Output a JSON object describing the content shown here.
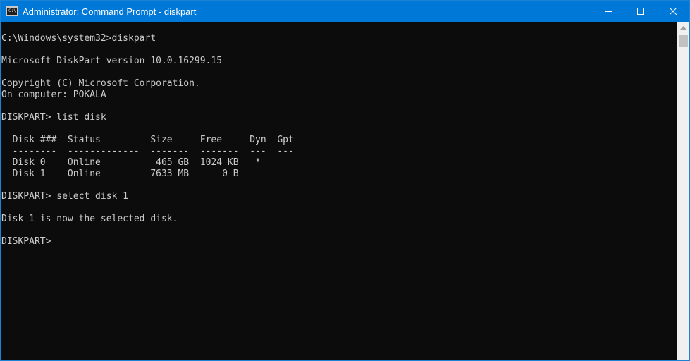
{
  "window": {
    "title": "Administrator: Command Prompt - diskpart",
    "icon_text": "C:\\"
  },
  "console": {
    "lines": [
      "",
      "C:\\Windows\\system32>diskpart",
      "",
      "Microsoft DiskPart version 10.0.16299.15",
      "",
      "Copyright (C) Microsoft Corporation.",
      "On computer: POKALA",
      "",
      "DISKPART> list disk",
      "",
      "  Disk ###  Status         Size     Free     Dyn  Gpt",
      "  --------  -------------  -------  -------  ---  ---",
      "  Disk 0    Online          465 GB  1024 KB   *",
      "  Disk 1    Online         7633 MB      0 B",
      "",
      "DISKPART> select disk 1",
      "",
      "Disk 1 is now the selected disk.",
      "",
      "DISKPART> "
    ]
  },
  "icons": {
    "app": "cmd-app-icon",
    "minimize": "minimize-icon",
    "maximize": "maximize-icon",
    "close": "close-icon",
    "scroll_up": "scroll-up-arrow-icon"
  },
  "colors": {
    "titlebar": "#0078d7",
    "console_bg": "#0c0c0c",
    "console_fg": "#cccccc"
  }
}
